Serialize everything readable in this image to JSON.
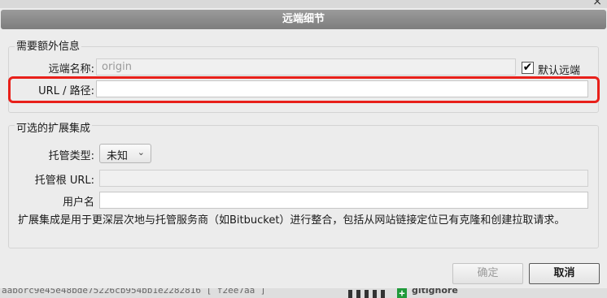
{
  "dialog": {
    "title": "远端细节",
    "required_section": {
      "legend": "需要额外信息",
      "remote_name_label": "远端名称:",
      "remote_name_value": "origin",
      "default_remote_label": "默认远端",
      "default_remote_checked": true,
      "url_label": "URL / 路径:",
      "url_value": ""
    },
    "optional_section": {
      "legend": "可选的扩展集成",
      "host_type_label": "托管类型:",
      "host_type_value": "未知",
      "host_root_url_label": "托管根 URL:",
      "host_root_url_value": "",
      "username_label": "用户名",
      "username_value": "",
      "description": "扩展集成是用于更深层次地与托管服务商（如Bitbucket）进行整合，包括从网站链接定位已有克隆和创建拉取请求。"
    },
    "buttons": {
      "ok": "确定",
      "cancel": "取消"
    }
  },
  "background": {
    "commit_hash_text": "aaborc9e45e48bde75226cb954bb1e2282816 [ f2ee7aa ]",
    "file_name": "gitignore",
    "close_glyph": "×"
  },
  "colors": {
    "highlight": "#e8201a",
    "title_bar": "#8a8a8a",
    "added_file": "#1f9a3a"
  }
}
